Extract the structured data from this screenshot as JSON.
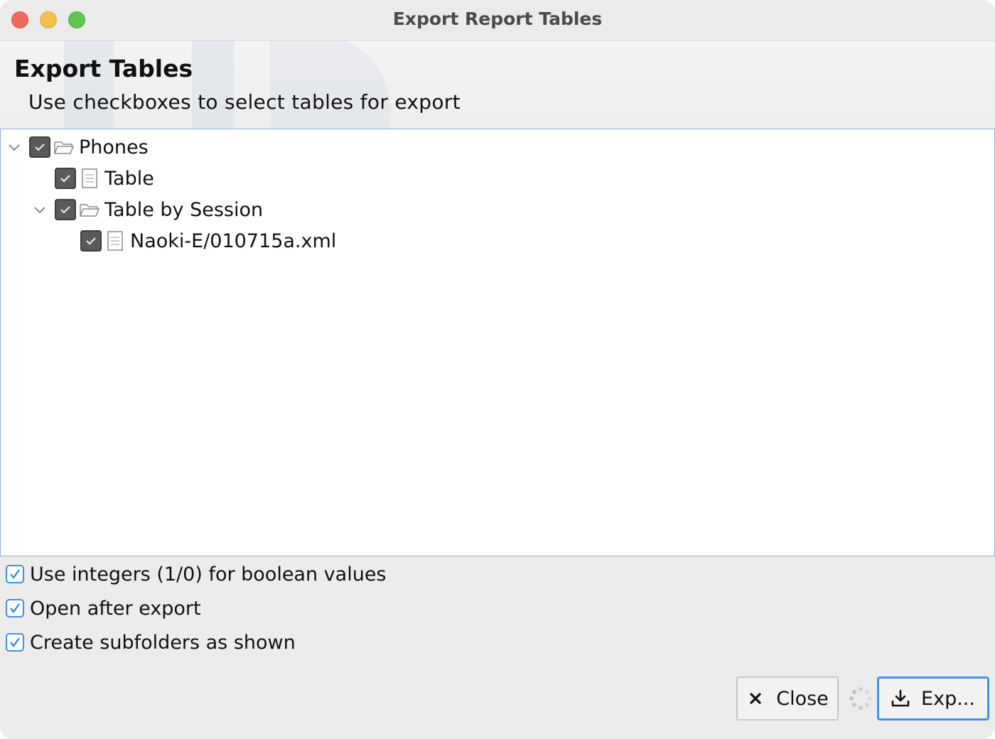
{
  "window": {
    "title": "Export Report Tables"
  },
  "header": {
    "title": "Export Tables",
    "subtitle": "Use checkboxes to select tables for export"
  },
  "tree": {
    "items": [
      {
        "label": "Phones",
        "checked": true,
        "expanded": true,
        "icon": "folder-icon"
      },
      {
        "label": "Table",
        "checked": true,
        "icon": "document-icon"
      },
      {
        "label": "Table by Session",
        "checked": true,
        "expanded": true,
        "icon": "folder-icon"
      },
      {
        "label": "Naoki-E/010715a.xml",
        "checked": true,
        "icon": "document-icon"
      }
    ]
  },
  "options": [
    {
      "label": "Use integers (1/0) for boolean values",
      "checked": true
    },
    {
      "label": "Open after export",
      "checked": true
    },
    {
      "label": "Create subfolders as shown",
      "checked": true
    }
  ],
  "buttons": {
    "close_label": "Close",
    "export_label": "Exp..."
  },
  "colors": {
    "accent": "#4a90e2",
    "tree_border": "#8fb0d8",
    "checkbox_dark": "#5a5a5a"
  }
}
